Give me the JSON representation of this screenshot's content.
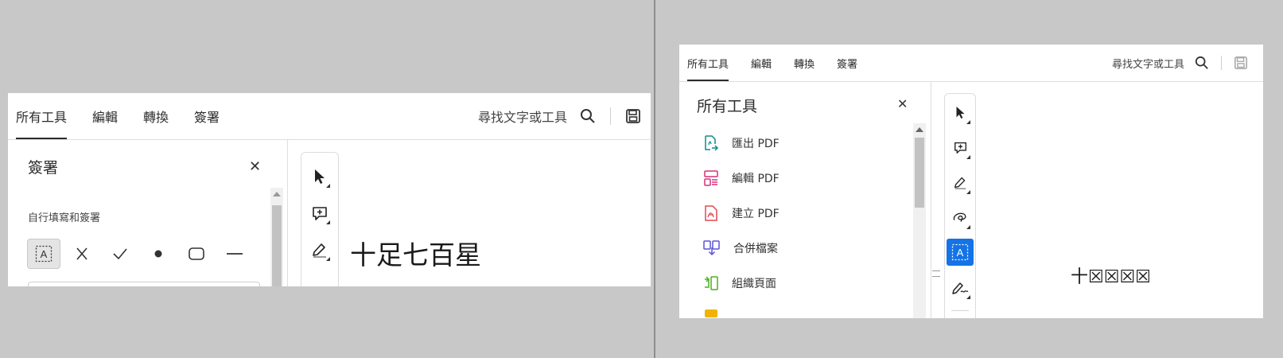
{
  "colors": {
    "accent": "#1473e6",
    "background": "#c8c8c8",
    "export": "#0f8c8c",
    "edit": "#d4317d",
    "create": "#e34850",
    "combine": "#5a54d6",
    "organize": "#4caf1e",
    "partial": "#f0b400"
  },
  "tabs": [
    "所有工具",
    "編輯",
    "轉換",
    "簽署"
  ],
  "search_placeholder": "尋找文字或工具",
  "left_window": {
    "active_tab": "所有工具",
    "panel_title": "簽署",
    "section_label": "自行填寫和簽署",
    "fill_sign_tools": [
      "text-field-icon",
      "cross-icon",
      "check-icon",
      "dot-icon",
      "rounded-rect-icon",
      "line-icon"
    ],
    "doc_text": "十足七百星"
  },
  "right_window": {
    "active_tab": "所有工具",
    "panel_title": "所有工具",
    "tools": [
      {
        "label": "匯出 PDF",
        "icon": "export-pdf-icon"
      },
      {
        "label": "編輯 PDF",
        "icon": "edit-pdf-icon"
      },
      {
        "label": "建立 PDF",
        "icon": "create-pdf-icon"
      },
      {
        "label": "合併檔案",
        "icon": "combine-files-icon"
      },
      {
        "label": "組織頁面",
        "icon": "organize-pages-icon"
      }
    ],
    "doc_text": "十☒☒☒☒"
  },
  "vertical_tools": [
    "select-cursor-icon",
    "add-comment-icon",
    "highlight-icon",
    "freehand-draw-icon",
    "text-field-icon",
    "sign-icon"
  ]
}
